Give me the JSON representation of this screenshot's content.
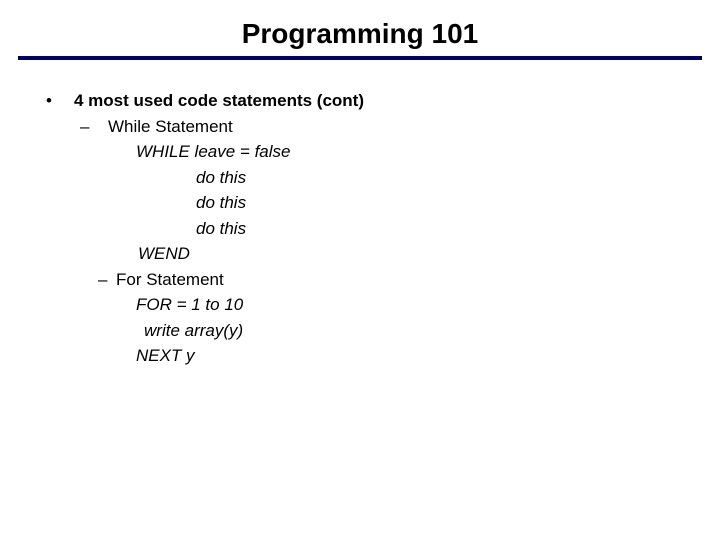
{
  "title": "Programming 101",
  "bullet": {
    "mark": "•",
    "text": "4 most used code statements (cont)"
  },
  "dash": "–",
  "sub1": {
    "label": "While Statement",
    "line1": "WHILE leave = false",
    "do": "do this",
    "end": "WEND"
  },
  "sub2": {
    "label": "For Statement",
    "line1": "FOR = 1 to 10",
    "line2": "write array(y)",
    "line3": "NEXT y"
  }
}
